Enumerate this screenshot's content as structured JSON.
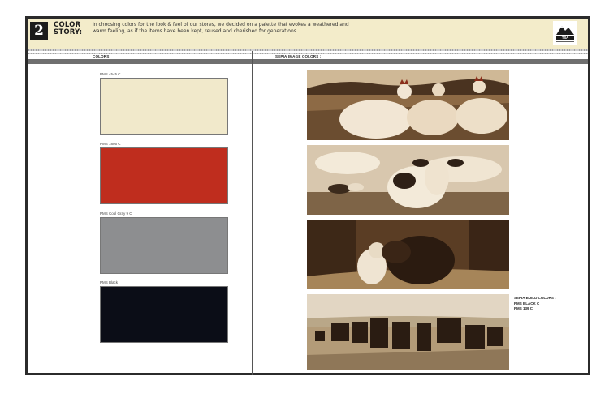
{
  "header": {
    "section_number": "2",
    "title_line1": "COLOR",
    "title_line2": "STORY:",
    "intro": "In choosing colors for the look & feel of our stores, we decided on a palette that evokes a weathered and warm feeling, as if the items have been kept, reused and cherished for generations.",
    "logo_text": "TSA"
  },
  "columns": {
    "colors_label": "COLORS:",
    "sepia_label": "SEPIA IMAGE COLORS :"
  },
  "swatches": [
    {
      "label": "PMS 4545 C",
      "color": "#f1e9cb"
    },
    {
      "label": "PMS 1805 C",
      "color": "#bf2d1e"
    },
    {
      "label": "PMS Cool Gray 9 C",
      "color": "#8d8e90"
    },
    {
      "label": "PMS Black",
      "color": "#0b0d17"
    }
  ],
  "photos": [
    {
      "subject": "chickens-photo"
    },
    {
      "subject": "cow-photo"
    },
    {
      "subject": "cat-and-dog-photo"
    },
    {
      "subject": "horses-photo"
    }
  ],
  "sepia_build": {
    "line1": "SEPIA BUILD COLORS :",
    "line2": "PMS BLACK C",
    "line3": "PMS 139 C"
  }
}
